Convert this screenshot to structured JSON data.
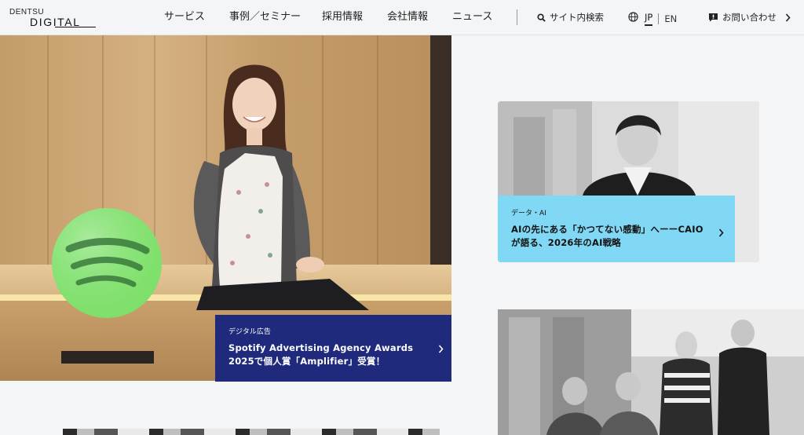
{
  "header": {
    "logo": {
      "top": "DENTSU",
      "bottom": "DIGITAL"
    },
    "nav": [
      {
        "label": "サービス"
      },
      {
        "label": "事例／セミナー"
      },
      {
        "label": "採用情報"
      },
      {
        "label": "会社情報"
      },
      {
        "label": "ニュース"
      }
    ],
    "search_label": "サイト内検索",
    "language": {
      "current": "JP",
      "other": "EN"
    },
    "contact_label": "お問い合わせ"
  },
  "hero": {
    "category": "デジタル広告",
    "title_line1": "Spotify Advertising Agency Awards",
    "title_line2": "2025で個人賞「Amplifier」受賞！"
  },
  "side_cards": [
    {
      "category": "データ・AI",
      "title_line1": "AIの先にある「かつてない感動」へーーCAIO",
      "title_line2": "が語る、2026年のAI戦略",
      "card_color": "#80d8f5"
    }
  ],
  "colors": {
    "hero_card": "#1f2a7c",
    "side_card": "#80d8f5",
    "background": "#f4f5f7"
  },
  "icons": {
    "search": "search-icon",
    "globe": "globe-icon",
    "contact": "chat-icon",
    "chevron": "chevron-right-icon"
  }
}
